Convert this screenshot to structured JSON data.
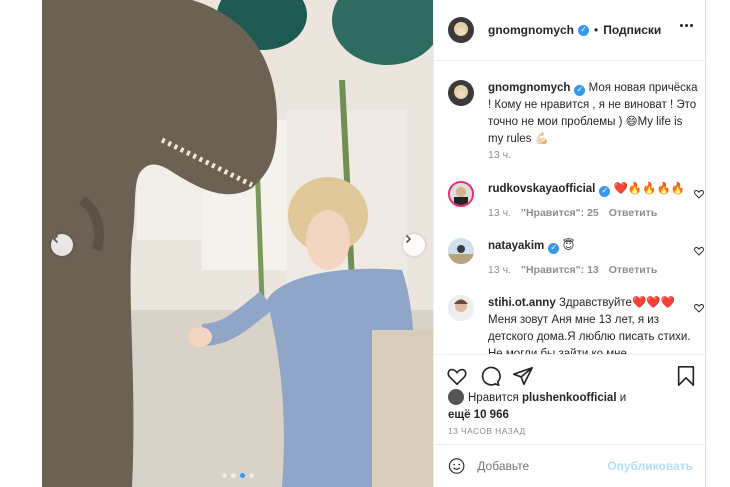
{
  "post": {
    "author": "gnomgnomych",
    "follow_label": "Подписки",
    "caption_text": "Моя новая причёска ! Кому не нравится , я не виноват ! Это точно не мои проблемы ) 😄My life is my rules 💪🏻",
    "caption_time": "13 ч."
  },
  "comments": [
    {
      "user": "rudkovskayaofficial",
      "text": "❤️🔥🔥🔥🔥",
      "time": "13 ч.",
      "likes": "\"Нравится\": 25",
      "reply": "Ответить"
    },
    {
      "user": "natayakim",
      "text": "😇",
      "time": "13 ч.",
      "likes": "\"Нравится\": 13",
      "reply": "Ответить"
    },
    {
      "user": "stihi.ot.anny",
      "text": "Здравствуйте❤️❤️❤️ Меня зовут Аня мне 13 лет, я из детского дома.Я люблю писать стихи. Не могли бы зайти ко мне",
      "time": "",
      "likes": "",
      "reply": ""
    }
  ],
  "liked_by": {
    "prefix": "Нравится",
    "user": "plushenkoofficial",
    "conj": "и",
    "others": "ещё 10 966"
  },
  "timestamp": "13 ЧАСОВ НАЗАД",
  "composer": {
    "placeholder": "Добавьте",
    "publish": "Опубликовать"
  },
  "carousel": {
    "slides": 4,
    "active": 3
  },
  "colors": {
    "accent": "#3897f0",
    "publish_disabled": "#b2dffc",
    "heart": "#ed4956"
  },
  "icons": [
    "chevron-left-icon",
    "chevron-right-icon",
    "more-icon",
    "heart-icon",
    "comment-icon",
    "share-icon",
    "bookmark-icon",
    "emoji-icon",
    "verified-icon"
  ]
}
